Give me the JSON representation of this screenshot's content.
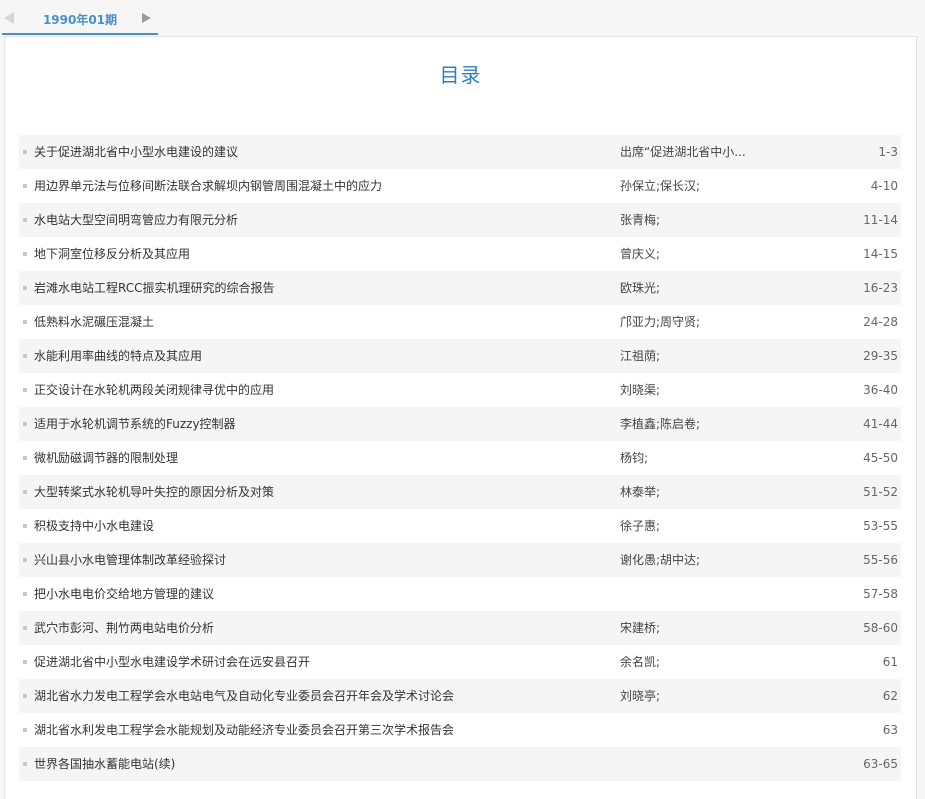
{
  "tabbar": {
    "active_tab": "1990年01期"
  },
  "page_title": "目录",
  "articles": [
    {
      "title": "关于促进湖北省中小型水电建设的建议",
      "author": "出席“促进湖北省中小...",
      "pages": "1-3"
    },
    {
      "title": "用边界单元法与位移间断法联合求解坝内钢管周围混凝土中的应力",
      "author": "孙保立;保长汉;",
      "pages": "4-10"
    },
    {
      "title": "水电站大型空间明弯管应力有限元分析",
      "author": "张青梅;",
      "pages": "11-14"
    },
    {
      "title": "地下洞室位移反分析及其应用",
      "author": "曾庆义;",
      "pages": "14-15"
    },
    {
      "title": "岩滩水电站工程RCC振实机理研究的综合报告",
      "author": "欧珠光;",
      "pages": "16-23"
    },
    {
      "title": "低熟料水泥碾压混凝土",
      "author": "邝亚力;周守贤;",
      "pages": "24-28"
    },
    {
      "title": "水能利用率曲线的特点及其应用",
      "author": "江祖荫;",
      "pages": "29-35"
    },
    {
      "title": "正交设计在水轮机两段关闭规律寻优中的应用",
      "author": "刘晓渠;",
      "pages": "36-40"
    },
    {
      "title": "适用于水轮机调节系统的Fuzzy控制器",
      "author": "李植鑫;陈启卷;",
      "pages": "41-44"
    },
    {
      "title": "微机励磁调节器的限制处理",
      "author": "杨钧;",
      "pages": "45-50"
    },
    {
      "title": "大型转桨式水轮机导叶失控的原因分析及对策",
      "author": "林泰举;",
      "pages": "51-52"
    },
    {
      "title": "积极支持中小水电建设",
      "author": "徐子惠;",
      "pages": "53-55"
    },
    {
      "title": "兴山县小水电管理体制改革经验探讨",
      "author": "谢化愚;胡中达;",
      "pages": "55-56"
    },
    {
      "title": "把小水电电价交给地方管理的建议",
      "author": "",
      "pages": "57-58"
    },
    {
      "title": "武穴市彭河、荆竹两电站电价分析",
      "author": "宋建桥;",
      "pages": "58-60"
    },
    {
      "title": "促进湖北省中小型水电建设学术研讨会在远安县召开",
      "author": "余名凯;",
      "pages": "61"
    },
    {
      "title": "湖北省水力发电工程学会水电站电气及自动化专业委员会召开年会及学术讨论会",
      "author": "刘晓亭;",
      "pages": "62"
    },
    {
      "title": "湖北省水利发电工程学会水能规划及动能经济专业委员会召开第三次学术报告会",
      "author": "",
      "pages": "63"
    },
    {
      "title": "世界各国抽水蓄能电站(续)",
      "author": "",
      "pages": "63-65"
    }
  ]
}
